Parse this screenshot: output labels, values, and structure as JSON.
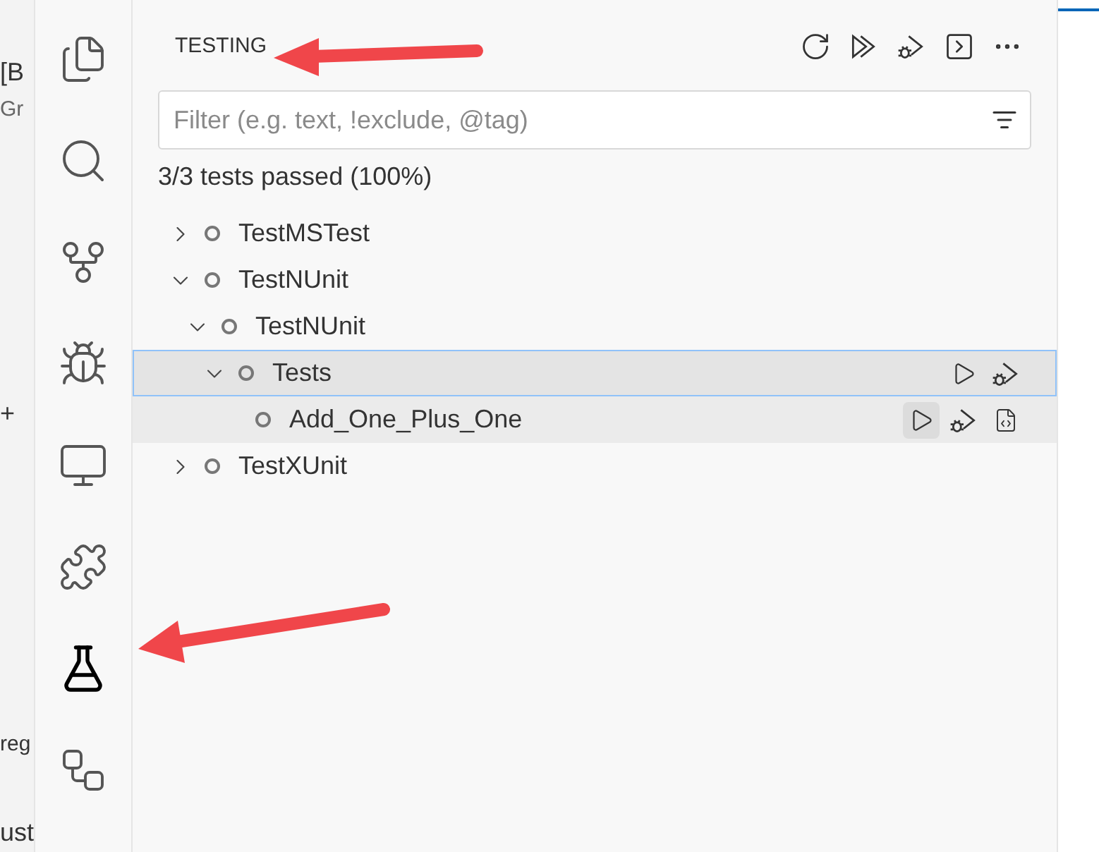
{
  "background_window": {
    "texts": [
      "[B",
      "Gr",
      "+",
      "reg",
      "ust"
    ]
  },
  "activity_bar": {
    "items": [
      {
        "kind": "files",
        "selected": false
      },
      {
        "kind": "search",
        "selected": false
      },
      {
        "kind": "source-control",
        "selected": false
      },
      {
        "kind": "debug",
        "selected": false
      },
      {
        "kind": "remote",
        "selected": false
      },
      {
        "kind": "extensions",
        "selected": false
      },
      {
        "kind": "testing",
        "selected": true
      },
      {
        "kind": "diagram",
        "selected": false
      }
    ]
  },
  "sidebar": {
    "title": "TESTING",
    "toolbar": [
      {
        "kind": "refresh"
      },
      {
        "kind": "run-all"
      },
      {
        "kind": "debug-all"
      },
      {
        "kind": "output"
      },
      {
        "kind": "more"
      }
    ],
    "filter": {
      "placeholder": "Filter (e.g. text, !exclude, @tag)"
    },
    "summary": "3/3 tests passed (100%)",
    "tree": [
      {
        "label": "TestMSTest",
        "expanded": false,
        "selected": false
      },
      {
        "label": "TestNUnit",
        "expanded": true,
        "selected": false,
        "children": [
          {
            "label": "TestNUnit",
            "expanded": true,
            "selected": false,
            "children": [
              {
                "label": "Tests",
                "expanded": true,
                "selected": true,
                "actions": [
                  {
                    "kind": "run"
                  },
                  {
                    "kind": "debug"
                  }
                ],
                "children": [
                  {
                    "label": "Add_One_Plus_One",
                    "selected": false,
                    "hovered": true,
                    "actions": [
                      {
                        "kind": "run",
                        "hovered": true
                      },
                      {
                        "kind": "debug",
                        "hovered": false
                      },
                      {
                        "kind": "file",
                        "hovered": false
                      }
                    ]
                  }
                ]
              }
            ]
          }
        ]
      },
      {
        "label": "TestXUnit",
        "expanded": false,
        "selected": false
      }
    ]
  },
  "annotations": [
    {
      "kind": "arrow"
    },
    {
      "kind": "arrow"
    }
  ]
}
